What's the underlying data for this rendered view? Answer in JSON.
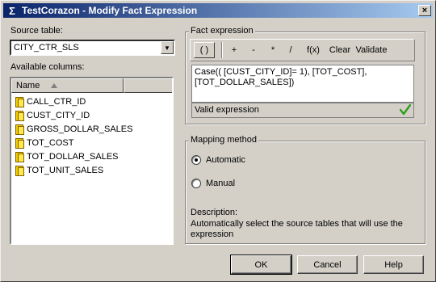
{
  "window": {
    "title": "TestCorazon - Modify Fact Expression",
    "icon": "sigma-icon",
    "close_label": "×"
  },
  "source_table": {
    "label": "Source table:",
    "value": "CITY_CTR_SLS"
  },
  "available_columns": {
    "label": "Available columns:",
    "header": "Name",
    "items": [
      "CALL_CTR_ID",
      "CUST_CITY_ID",
      "GROSS_DOLLAR_SALES",
      "TOT_COST",
      "TOT_DOLLAR_SALES",
      "TOT_UNIT_SALES"
    ]
  },
  "fact_expression": {
    "group_label": "Fact expression",
    "toolbar": [
      "( )",
      "+",
      "-",
      "*",
      "/",
      "f(x)",
      "Clear",
      "Validate"
    ],
    "expression_line1": "Case(( [CUST_CITY_ID]= 1),  [TOT_COST],",
    "expression_line2": "[TOT_DOLLAR_SALES])",
    "status": "Valid expression",
    "status_color": "#2e9e1e"
  },
  "mapping_method": {
    "group_label": "Mapping method",
    "options": [
      {
        "label": "Automatic",
        "selected": true
      },
      {
        "label": "Manual",
        "selected": false
      }
    ],
    "description_label": "Description:",
    "description_text": "Automatically select the source tables that will use the expression"
  },
  "buttons": {
    "ok": "OK",
    "cancel": "Cancel",
    "help": "Help"
  }
}
